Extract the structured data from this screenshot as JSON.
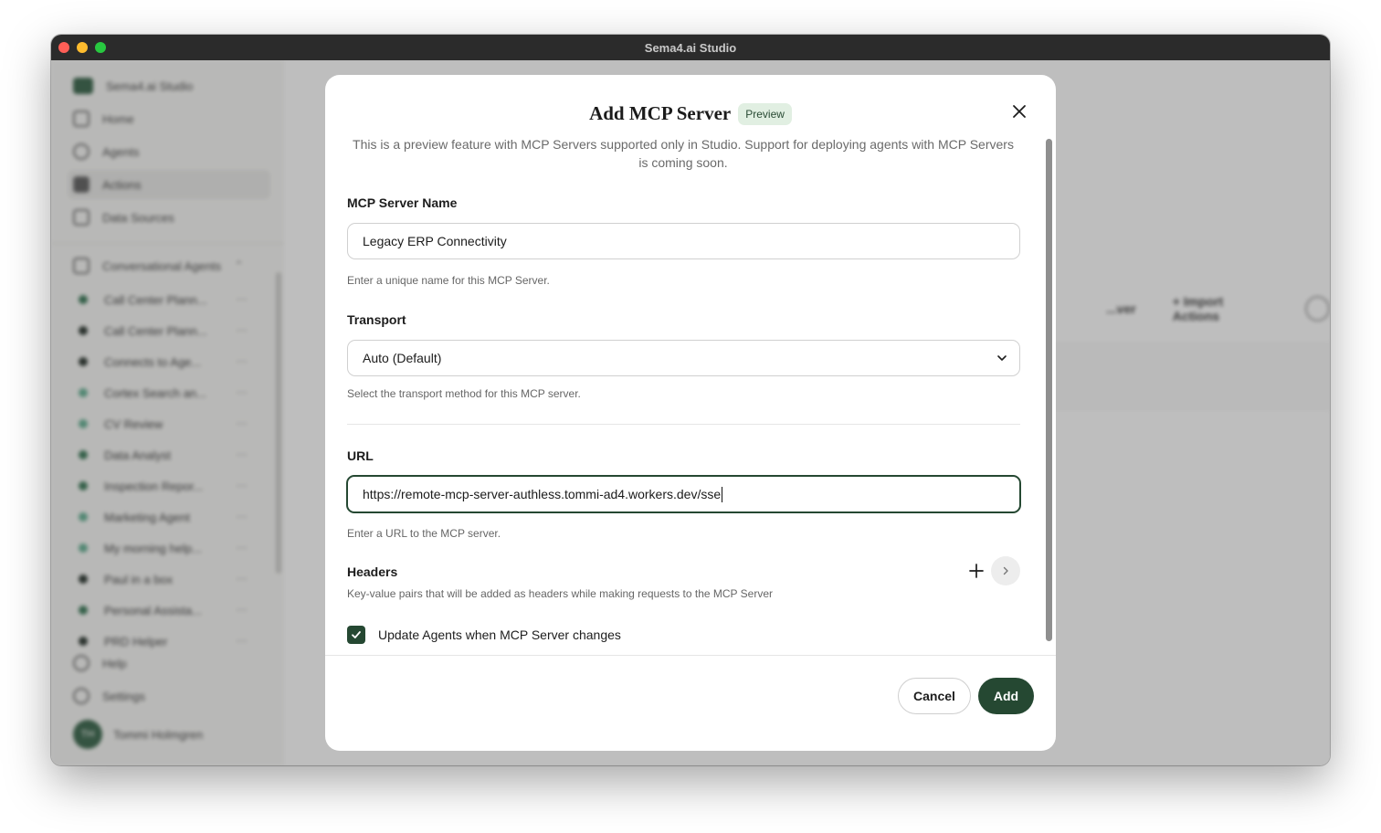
{
  "window": {
    "title": "Sema4.ai Studio"
  },
  "sidebar": {
    "brand": "Sema4.ai Studio",
    "nav": [
      {
        "label": "Home",
        "icon": "home-icon"
      },
      {
        "label": "Agents",
        "icon": "agents-icon"
      },
      {
        "label": "Actions",
        "icon": "actions-icon"
      },
      {
        "label": "Data Sources",
        "icon": "database-icon"
      }
    ],
    "section": "Conversational Agents",
    "agents": [
      {
        "label": "Call Center Plann...",
        "color": "#2e6f4d"
      },
      {
        "label": "Call Center Plann...",
        "color": "#1f2b24"
      },
      {
        "label": "Connects to Age...",
        "color": "#1f2b24"
      },
      {
        "label": "Cortex Search an...",
        "color": "#5aa88a"
      },
      {
        "label": "CV Review",
        "color": "#5aa88a"
      },
      {
        "label": "Data Analyst",
        "color": "#2e6f4d"
      },
      {
        "label": "Inspection Repor...",
        "color": "#2e6f4d"
      },
      {
        "label": "Marketing Agent",
        "color": "#5aa88a"
      },
      {
        "label": "My morning help...",
        "color": "#5aa88a"
      },
      {
        "label": "Paul in a box",
        "color": "#1f2b24"
      },
      {
        "label": "Personal Assista...",
        "color": "#2e6f4d"
      },
      {
        "label": "PRD Helper",
        "color": "#1f2b24"
      }
    ],
    "help": "Help",
    "settings": "Settings",
    "user": {
      "initials": "TH",
      "name": "Tommi Holmgren"
    }
  },
  "main": {
    "toolbar_partial": "...ver",
    "import_actions": "Import Actions"
  },
  "modal": {
    "title": "Add MCP Server",
    "badge": "Preview",
    "description": "This is a preview feature with MCP Servers supported only in Studio. Support for deploying agents with MCP Servers is coming soon.",
    "name_label": "MCP Server Name",
    "name_value": "Legacy ERP Connectivity",
    "name_help": "Enter a unique name for this MCP Server.",
    "transport_label": "Transport",
    "transport_value": "Auto (Default)",
    "transport_help": "Select the transport method for this MCP server.",
    "url_label": "URL",
    "url_value": "https://remote-mcp-server-authless.tommi-ad4.workers.dev/sse",
    "url_help": "Enter a URL to the MCP server.",
    "headers_label": "Headers",
    "headers_help": "Key-value pairs that will be added as headers while making requests to the MCP Server",
    "update_agents_label": "Update Agents when MCP Server changes",
    "update_agents_checked": true,
    "cancel_label": "Cancel",
    "add_label": "Add"
  },
  "colors": {
    "accent": "#254832",
    "badge_bg": "#e1efe2"
  }
}
